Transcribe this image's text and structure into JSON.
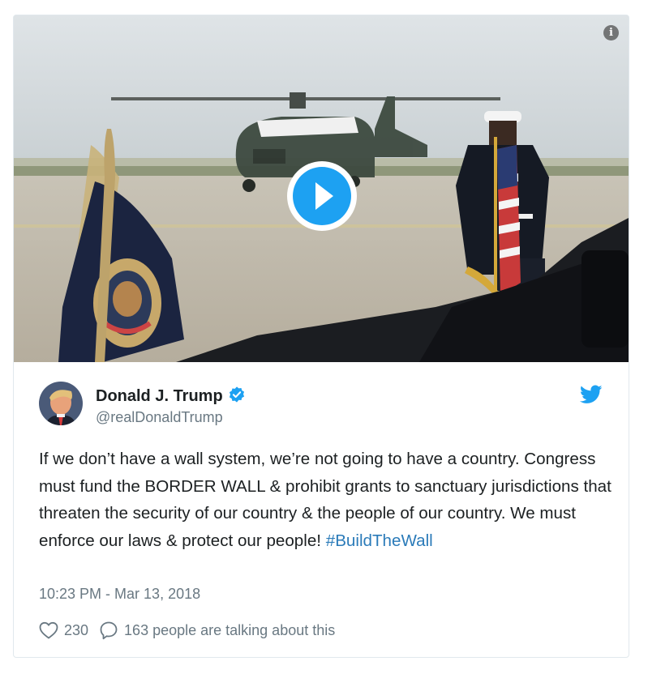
{
  "media": {
    "play_icon": "play-icon",
    "info_icon": "info-icon",
    "info_glyph": "i"
  },
  "tweet": {
    "display_name": "Donald J. Trump",
    "handle": "@realDonaldTrump",
    "verified_icon": "verified-badge-icon",
    "brand_icon": "twitter-bird-icon",
    "text": "If we don’t have a wall system, we’re not going to have a country. Congress must fund the BORDER WALL & prohibit grants to sanctuary jurisdictions that threaten the security of our country & the people of our country. We must enforce our laws & protect our people! ",
    "hashtag": "#BuildTheWall",
    "timestamp": "10:23 PM - Mar 13, 2018",
    "likes": "230",
    "conversation": "163 people are talking about this"
  },
  "colors": {
    "accent": "#1da1f2",
    "link": "#2b7bb9",
    "text": "#1c2022",
    "muted": "#697882",
    "border": "#e1e8ed"
  }
}
